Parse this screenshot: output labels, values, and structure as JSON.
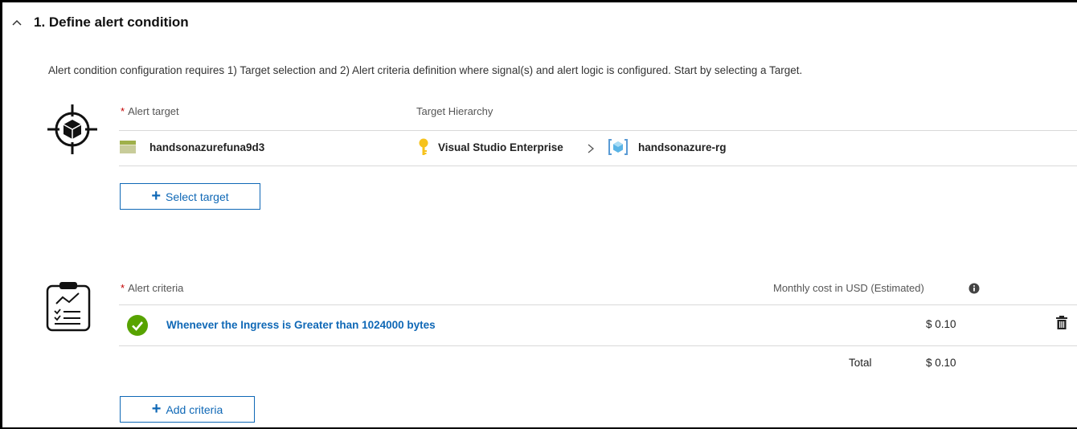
{
  "section": {
    "title": "1. Define alert condition",
    "description": "Alert condition configuration requires 1) Target selection and 2) Alert criteria definition where signal(s) and alert logic is configured. Start by selecting a Target."
  },
  "target": {
    "required_marker": "*",
    "label": "Alert target",
    "hierarchy_label": "Target Hierarchy",
    "resource_name": "handsonazurefuna9d3",
    "subscription": "Visual Studio Enterprise",
    "separator": ">",
    "resource_group": "handsonazure-rg",
    "select_button_label": "Select target"
  },
  "criteria": {
    "required_marker": "*",
    "label": "Alert criteria",
    "cost_header": "Monthly cost in USD (Estimated)",
    "items": [
      {
        "text": "Whenever the Ingress is Greater than 1024000 bytes",
        "cost": "$ 0.10"
      }
    ],
    "total_label": "Total",
    "total_value": "$ 0.10",
    "add_button_label": "Add criteria"
  },
  "colors": {
    "link": "#0f68b6",
    "required": "#c40000",
    "success": "#57a300"
  }
}
